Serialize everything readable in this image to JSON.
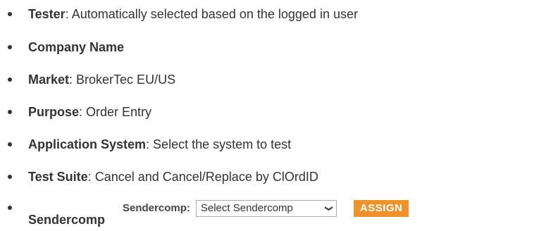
{
  "items": [
    {
      "term": "Tester",
      "detail": ": Automatically selected based on the logged in user"
    },
    {
      "term": "Company Name",
      "detail": ""
    },
    {
      "term": "Market",
      "detail": ": BrokerTec EU/US"
    },
    {
      "term": "Purpose",
      "detail": ": Order Entry"
    },
    {
      "term": "Application System",
      "detail": ": Select the system to test"
    },
    {
      "term": "Test Suite",
      "detail": ": Cancel and Cancel/Replace by ClOrdID"
    },
    {
      "term": "Sendercomp",
      "detail": ""
    }
  ],
  "sendercomp_widget": {
    "label": "Sendercomp:",
    "select_value": "Select Sendercomp",
    "assign_label": "ASSIGN",
    "assign_color": "#f0922b"
  }
}
